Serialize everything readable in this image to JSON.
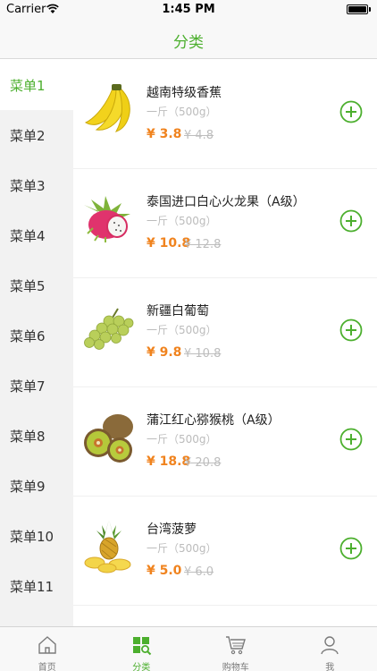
{
  "status_bar": {
    "carrier": "Carrier",
    "time": "1:45 PM"
  },
  "nav": {
    "title": "分类"
  },
  "sidebar": {
    "items": [
      {
        "label": "菜单1",
        "active": true
      },
      {
        "label": "菜单2"
      },
      {
        "label": "菜单3"
      },
      {
        "label": "菜单4"
      },
      {
        "label": "菜单5"
      },
      {
        "label": "菜单6"
      },
      {
        "label": "菜单7"
      },
      {
        "label": "菜单8"
      },
      {
        "label": "菜单9"
      },
      {
        "label": "菜单10"
      },
      {
        "label": "菜单11"
      }
    ]
  },
  "products": [
    {
      "name": "越南特级香蕉",
      "spec": "一斤（500g）",
      "price": "¥ 3.8",
      "old_price": "¥ 4.8",
      "icon": "banana-image"
    },
    {
      "name": "泰国进口白心火龙果（A级）",
      "spec": "一斤（500g）",
      "price": "¥ 10.8",
      "old_price": "¥ 12.8",
      "icon": "dragon-fruit-image"
    },
    {
      "name": "新疆白葡萄",
      "spec": "一斤（500g）",
      "price": "¥ 9.8",
      "old_price": "¥ 10.8",
      "icon": "grapes-image"
    },
    {
      "name": "蒲江红心猕猴桃（A级）",
      "spec": "一斤（500g）",
      "price": "¥ 18.8",
      "old_price": "¥ 20.8",
      "icon": "kiwi-image"
    },
    {
      "name": "台湾菠萝",
      "spec": "一斤（500g）",
      "price": "¥ 5.0",
      "old_price": "¥ 6.0",
      "icon": "pineapple-image"
    }
  ],
  "tabs": [
    {
      "label": "首页",
      "icon": "home-icon"
    },
    {
      "label": "分类",
      "icon": "category-icon",
      "active": true
    },
    {
      "label": "购物车",
      "icon": "cart-icon"
    },
    {
      "label": "我",
      "icon": "user-icon"
    }
  ],
  "colors": {
    "accent": "#4caf2e",
    "price": "#f0831e",
    "sidebar_bg": "#f2f2f2"
  }
}
